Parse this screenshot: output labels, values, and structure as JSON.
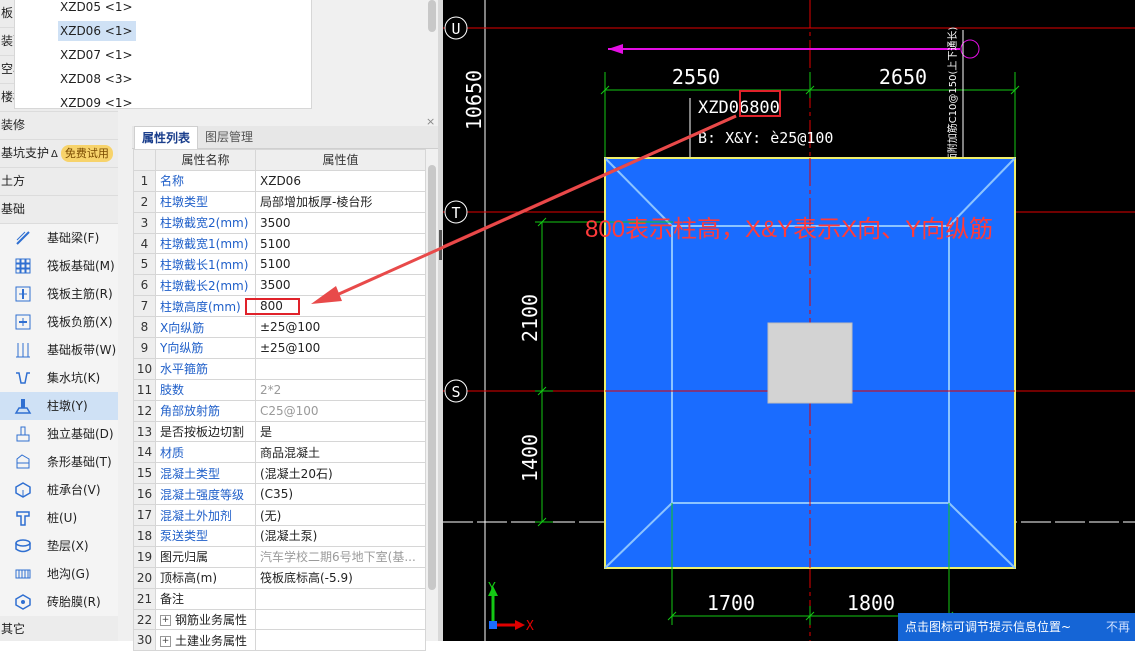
{
  "sidebar": {
    "categories_top": [
      {
        "label": "板",
        "dot": false
      },
      {
        "label": "装配式",
        "dot": true
      },
      {
        "label": "空心楼盖",
        "dot": false
      },
      {
        "label": "楼梯",
        "dot": true
      },
      {
        "label": "装修",
        "dot": false
      },
      {
        "label": "基坑支护",
        "dot": false,
        "badge": "免费试用"
      },
      {
        "label": "土方",
        "dot": false
      },
      {
        "label": "基础",
        "dot": false
      }
    ],
    "foundation_items": [
      {
        "label": "基础梁(F)",
        "icon": "foundation-beam-icon"
      },
      {
        "label": "筏板基础(M)",
        "icon": "raft-foundation-icon"
      },
      {
        "label": "筏板主筋(R)",
        "icon": "raft-main-rebar-icon"
      },
      {
        "label": "筏板负筋(X)",
        "icon": "raft-negative-rebar-icon"
      },
      {
        "label": "基础板带(W)",
        "icon": "foundation-strip-icon"
      },
      {
        "label": "集水坑(K)",
        "icon": "sump-pit-icon"
      },
      {
        "label": "柱墩(Y)",
        "icon": "column-pier-icon",
        "selected": true
      },
      {
        "label": "独立基础(D)",
        "icon": "isolated-footing-icon"
      },
      {
        "label": "条形基础(T)",
        "icon": "strip-footing-icon"
      },
      {
        "label": "桩承台(V)",
        "icon": "pile-cap-icon"
      },
      {
        "label": "桩(U)",
        "icon": "pile-icon"
      },
      {
        "label": "垫层(X)",
        "icon": "cushion-layer-icon"
      },
      {
        "label": "地沟(G)",
        "icon": "trench-icon"
      },
      {
        "label": "砖胎膜(R)",
        "icon": "brick-mould-icon"
      }
    ],
    "category_bottom": "其它"
  },
  "component_list": {
    "items": [
      {
        "label": "XZD05 <1>"
      },
      {
        "label": "XZD06 <1>",
        "selected": true
      },
      {
        "label": "XZD07 <1>"
      },
      {
        "label": "XZD08 <3>"
      },
      {
        "label": "XZD09 <1>"
      }
    ]
  },
  "panel": {
    "tabs": [
      "属性列表",
      "图层管理"
    ],
    "close_glyph": "×",
    "header_name": "属性名称",
    "header_value": "属性值"
  },
  "properties": [
    {
      "num": "1",
      "name": "名称",
      "value": "XZD06",
      "name_blue": true
    },
    {
      "num": "2",
      "name": "柱墩类型",
      "value": "局部增加板厚-棱台形",
      "name_blue": true
    },
    {
      "num": "3",
      "name": "柱墩截宽2(mm)",
      "value": "3500",
      "name_blue": true
    },
    {
      "num": "4",
      "name": "柱墩截宽1(mm)",
      "value": "5100",
      "name_blue": true
    },
    {
      "num": "5",
      "name": "柱墩截长1(mm)",
      "value": "5100",
      "name_blue": true
    },
    {
      "num": "6",
      "name": "柱墩截长2(mm)",
      "value": "3500",
      "name_blue": true
    },
    {
      "num": "7",
      "name": "柱墩高度(mm)",
      "value": "800",
      "name_blue": true
    },
    {
      "num": "8",
      "name": "X向纵筋",
      "value": "±25@100",
      "name_blue": true
    },
    {
      "num": "9",
      "name": "Y向纵筋",
      "value": "±25@100",
      "name_blue": true
    },
    {
      "num": "10",
      "name": "水平箍筋",
      "value": "",
      "name_blue": true
    },
    {
      "num": "11",
      "name": "肢数",
      "value": "2*2",
      "name_blue": true,
      "value_grey": true
    },
    {
      "num": "12",
      "name": "角部放射筋",
      "value": "C25@100",
      "name_blue": true,
      "value_grey": true
    },
    {
      "num": "13",
      "name": "是否按板边切割",
      "value": "是",
      "name_blue": false
    },
    {
      "num": "14",
      "name": "材质",
      "value": "商品混凝土",
      "name_blue": true
    },
    {
      "num": "15",
      "name": "混凝土类型",
      "value": "(混凝土20石)",
      "name_blue": true
    },
    {
      "num": "16",
      "name": "混凝土强度等级",
      "value": "(C35)",
      "name_blue": true
    },
    {
      "num": "17",
      "name": "混凝土外加剂",
      "value": "(无)",
      "name_blue": true
    },
    {
      "num": "18",
      "name": "泵送类型",
      "value": "(混凝土泵)",
      "name_blue": true
    },
    {
      "num": "19",
      "name": "图元归属",
      "value": "汽车学校二期6号地下室(基...",
      "name_blue": false,
      "value_grey": true
    },
    {
      "num": "20",
      "name": "顶标高(m)",
      "value": "筏板底标高(-5.9)",
      "name_blue": false
    },
    {
      "num": "21",
      "name": "备注",
      "value": "",
      "name_blue": false
    },
    {
      "num": "22",
      "name": "钢筋业务属性",
      "value": "",
      "name_blue": false,
      "expander": true
    },
    {
      "num": "30",
      "name": "土建业务属性",
      "value": "",
      "name_blue": false,
      "expander": true
    }
  ],
  "cad": {
    "axis_labels": [
      "U",
      "T",
      "S"
    ],
    "dim_left_top": "10650",
    "dim_top": [
      "2550",
      "2650"
    ],
    "dim_left": [
      "2100",
      "1400"
    ],
    "dim_bottom": [
      "1700",
      "1800"
    ],
    "label_main": "XZD06",
    "label_height": "800",
    "label_rebar": "B: X&Y:  è25@100",
    "vertical_text": "板面附加筋C10@150(上下通长)",
    "axis_x": "X",
    "axis_y": "Y",
    "colors": {
      "fill": "#1a6cff",
      "edge": "#f0ef6a",
      "dim": "#14c814",
      "axis": "#e00000",
      "magenta": "#e40ee4",
      "highlight": "#e0222a"
    }
  },
  "annotation": "800表示柱高，X&Y表示X向、Y向纵筋",
  "tip": {
    "text": "点击图标可调节提示信息位置~",
    "dismiss": "不再"
  }
}
